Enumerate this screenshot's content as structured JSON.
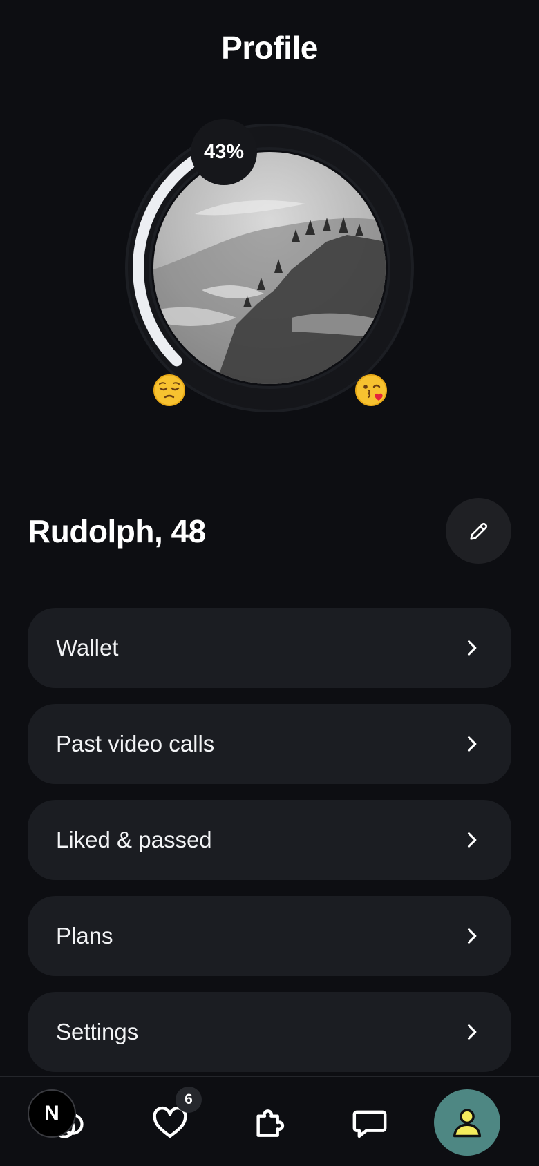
{
  "header": {
    "title": "Profile"
  },
  "profile": {
    "completion_label": "43%",
    "completion": 0.43,
    "name_age": "Rudolph, 48",
    "left_emoji": "pensive-face",
    "right_emoji": "face-blowing-kiss"
  },
  "menu": [
    {
      "label": "Wallet"
    },
    {
      "label": "Past video calls"
    },
    {
      "label": "Liked & passed"
    },
    {
      "label": "Plans"
    },
    {
      "label": "Settings"
    }
  ],
  "tabbar": {
    "likes_badge": "6",
    "items": [
      "discover-icon",
      "heart-icon",
      "puzzle-icon",
      "chat-icon",
      "profile-icon"
    ],
    "active": "profile-icon"
  },
  "overlay": {
    "letter": "N"
  },
  "colors": {
    "background": "#0d0e12",
    "card": "#1b1d22",
    "accent_active_tab": "#4e8783",
    "active_icon": "#f4ec5d"
  }
}
